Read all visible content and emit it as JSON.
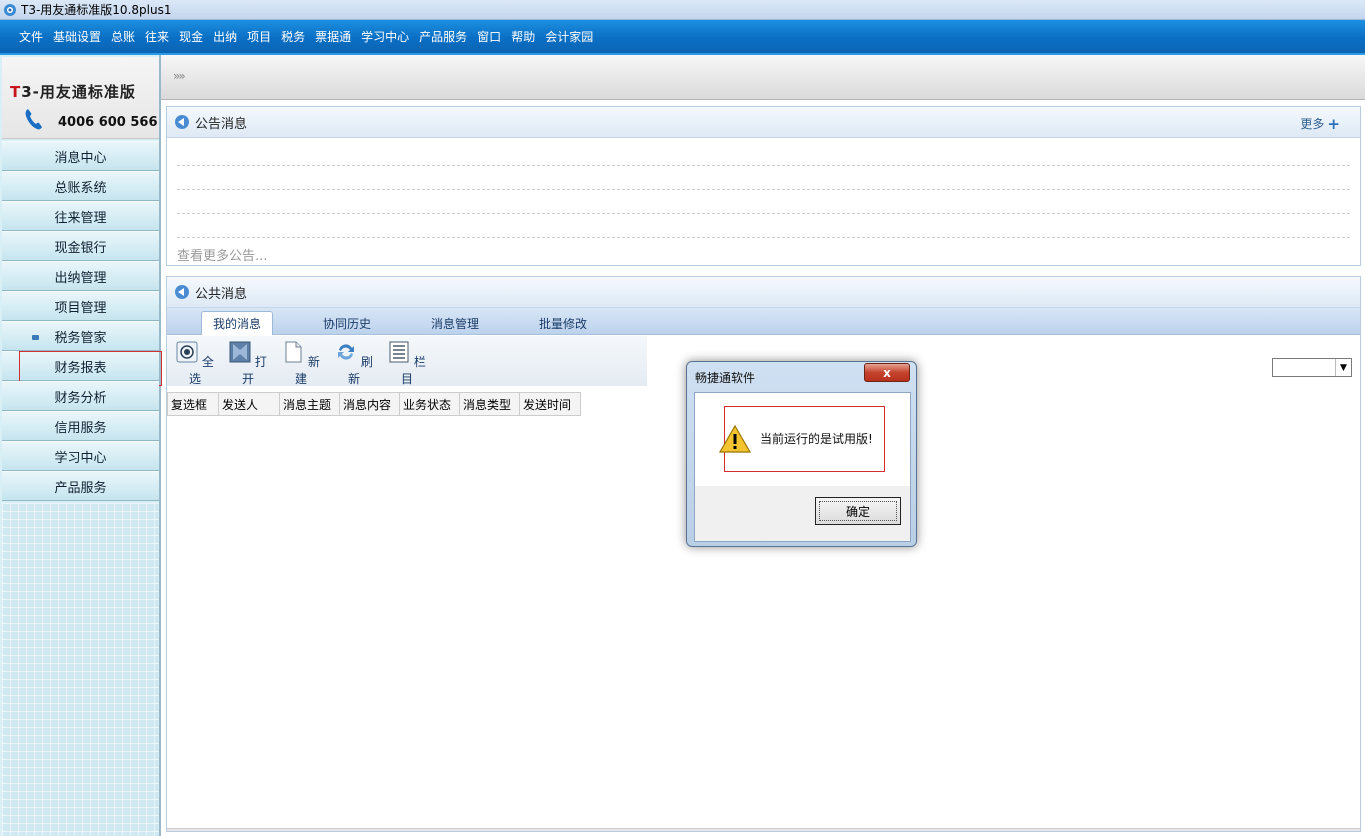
{
  "window": {
    "title": "T3-用友通标准版10.8plus1"
  },
  "menu": [
    "文件",
    "基础设置",
    "总账",
    "往来",
    "现金",
    "出纳",
    "项目",
    "税务",
    "票据通",
    "学习中心",
    "产品服务",
    "窗口",
    "帮助",
    "会计家园"
  ],
  "brand": {
    "logo_t": "T",
    "logo_rest": "3-用友通标准版",
    "phone": "4006 600 566"
  },
  "sidebar": {
    "items": [
      {
        "label": "消息中心"
      },
      {
        "label": "总账系统"
      },
      {
        "label": "往来管理"
      },
      {
        "label": "现金银行"
      },
      {
        "label": "出纳管理"
      },
      {
        "label": "项目管理"
      },
      {
        "label": "税务管家"
      },
      {
        "label": "财务报表"
      },
      {
        "label": "财务分析"
      },
      {
        "label": "信用服务"
      },
      {
        "label": "学习中心"
      },
      {
        "label": "产品服务"
      }
    ]
  },
  "topstrip": {
    "chevron": "»»"
  },
  "announcement": {
    "title": "公告消息",
    "more_label": "更多",
    "view_more": "查看更多公告..."
  },
  "public_msg": {
    "title": "公共消息",
    "tabs": [
      "我的消息",
      "协同历史",
      "消息管理",
      "批量修改"
    ],
    "toolbar": [
      "全选",
      "打开",
      "新建",
      "刷新",
      "栏目"
    ],
    "columns": [
      "复选框",
      "发送人",
      "消息主题",
      "消息内容",
      "业务状态",
      "消息类型",
      "发送时间"
    ]
  },
  "dialog": {
    "title": "畅捷通软件",
    "close_label": "x",
    "message": "当前运行的是试用版!",
    "ok_label": "确定"
  },
  "colors": {
    "menubar": "#0a6fc4",
    "sidebar": "#d9eff6",
    "highlight_border": "#d32f2f"
  }
}
